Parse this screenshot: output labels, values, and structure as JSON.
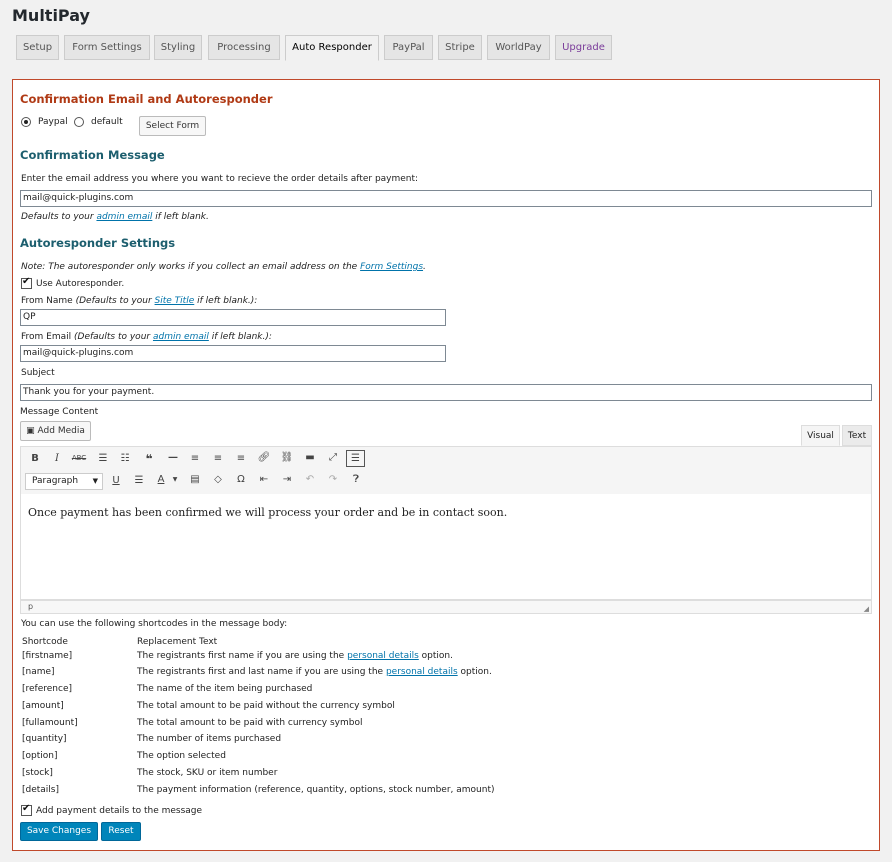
{
  "app_title": "MultiPay",
  "tabs": [
    "Setup",
    "Form Settings",
    "Styling",
    "Processing",
    "Auto Responder",
    "PayPal",
    "Stripe",
    "WorldPay",
    "Upgrade"
  ],
  "active_tab": "Auto Responder",
  "section1": {
    "heading": "Confirmation Email and Autoresponder",
    "radio_paypal": "Paypal",
    "radio_default": "default",
    "select_form_button": "Select Form"
  },
  "section2": {
    "heading": "Confirmation Message",
    "email_prompt": "Enter the email address you where you want to recieve the order details after payment:",
    "email_value": "mail@quick-plugins.com",
    "defaults_prefix": "Defaults to your",
    "defaults_link": "admin email",
    "defaults_suffix": "if left blank."
  },
  "section3": {
    "heading": "Autoresponder Settings",
    "note_prefix": "Note: The autoresponder only works if you collect an email address on the",
    "note_link": "Form Settings",
    "note_suffix": ".",
    "use_autoresponder": "Use Autoresponder.",
    "from_name_label": "From Name",
    "from_name_hint_prefix": "(Defaults to your",
    "from_name_hint_link": "Site Title",
    "from_name_hint_suffix": "if left blank.):",
    "from_name_value": "QP",
    "from_email_label": "From Email",
    "from_email_hint_prefix": "(Defaults to your",
    "from_email_hint_link": "admin email",
    "from_email_hint_suffix": "if left blank.):",
    "from_email_value": "mail@quick-plugins.com",
    "subject_label": "Subject",
    "subject_value": "Thank you for your payment.",
    "message_label": "Message Content",
    "add_media": "Add Media",
    "tab_visual": "Visual",
    "tab_text": "Text",
    "format_select": "Paragraph",
    "editor_content": "Once payment has been confirmed we will process your order and be in contact soon.",
    "status_path": "p"
  },
  "shortcodes": {
    "intro": "You can use the following shortcodes in the message body:",
    "header_code": "Shortcode",
    "header_text": "Replacement Text",
    "rows": [
      {
        "code": "[firstname]",
        "pre": "The registrants first name if you are using the",
        "link": "personal details",
        "post": "option."
      },
      {
        "code": "[name]",
        "pre": "The registrants first and last name if you are using the",
        "link": "personal details",
        "post": "option."
      },
      {
        "code": "[reference]",
        "pre": "The name of the item being purchased",
        "link": "",
        "post": ""
      },
      {
        "code": "[amount]",
        "pre": "The total amount to be paid without the currency symbol",
        "link": "",
        "post": ""
      },
      {
        "code": "[fullamount]",
        "pre": "The total amount to be paid with currency symbol",
        "link": "",
        "post": ""
      },
      {
        "code": "[quantity]",
        "pre": "The number of items purchased",
        "link": "",
        "post": ""
      },
      {
        "code": "[option]",
        "pre": "The option selected",
        "link": "",
        "post": ""
      },
      {
        "code": "[stock]",
        "pre": "The stock, SKU or item number",
        "link": "",
        "post": ""
      },
      {
        "code": "[details]",
        "pre": "The payment information (reference, quantity, options, stock number, amount)",
        "link": "",
        "post": ""
      }
    ]
  },
  "add_payment_details": "Add payment details to the message",
  "save_button": "Save Changes",
  "reset_button": "Reset",
  "colors": {
    "accent_red": "#b03a15",
    "heading_teal": "#1c5e6e",
    "button_blue": "#0085ba",
    "link": "#0073aa",
    "upgrade_purple": "#7a3c9a"
  }
}
